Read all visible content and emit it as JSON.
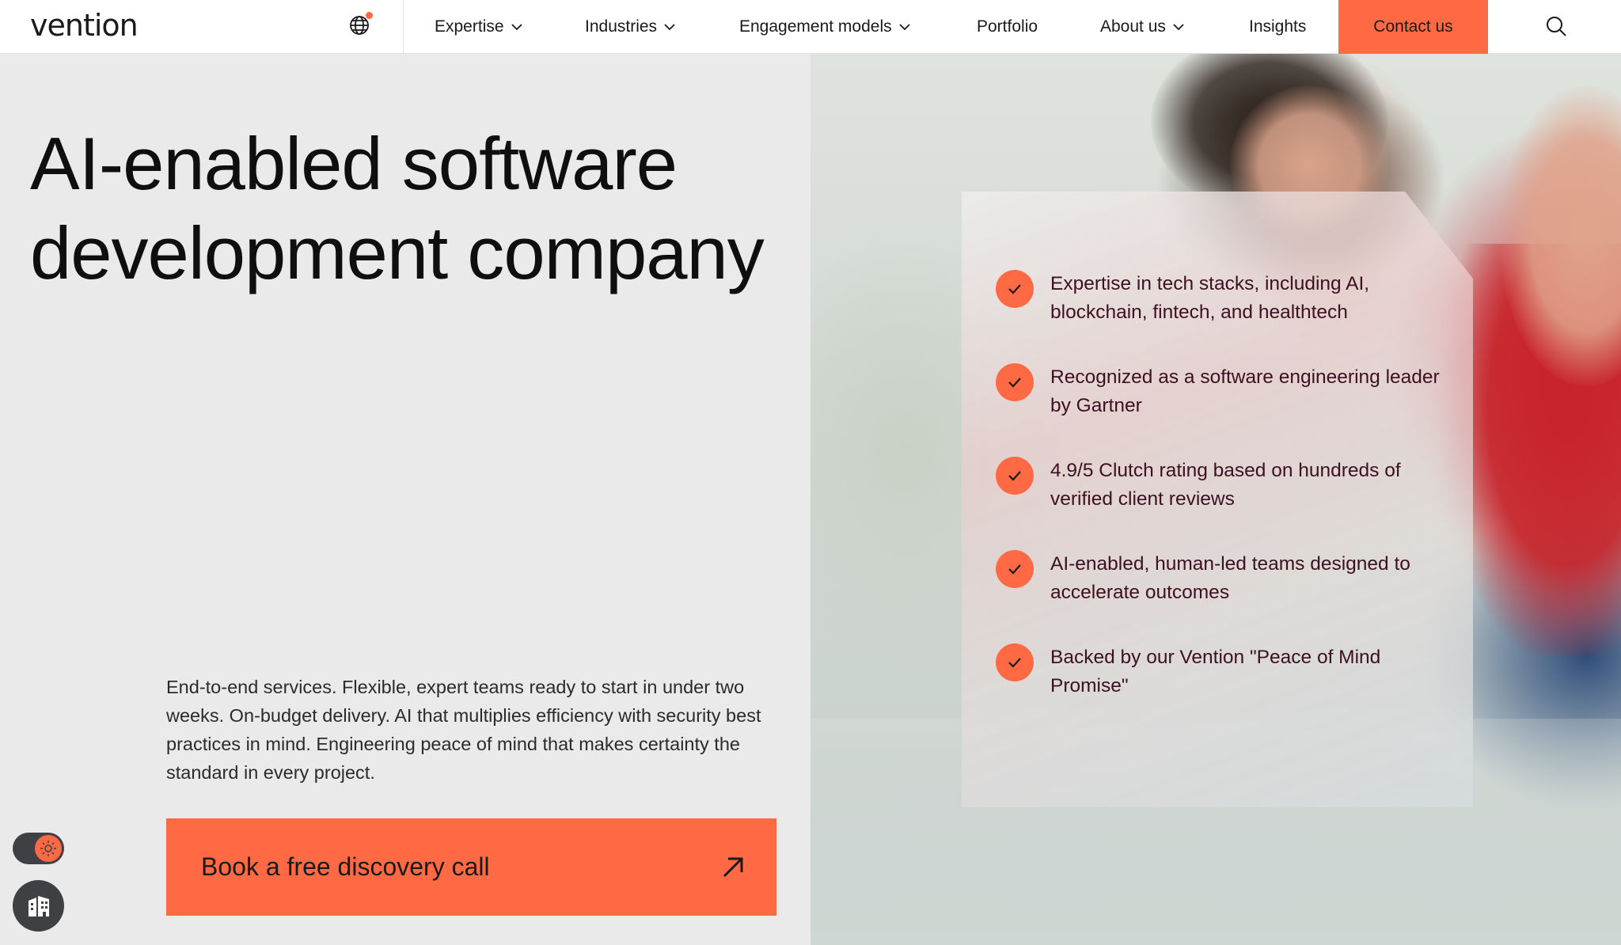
{
  "header": {
    "logo": "vention",
    "nav": [
      {
        "label": "Expertise",
        "has_dropdown": true
      },
      {
        "label": "Industries",
        "has_dropdown": true
      },
      {
        "label": "Engagement models",
        "has_dropdown": true
      },
      {
        "label": "Portfolio",
        "has_dropdown": false
      },
      {
        "label": "About us",
        "has_dropdown": true
      },
      {
        "label": "Insights",
        "has_dropdown": false
      }
    ],
    "contact_label": "Contact us",
    "icons": {
      "language": "globe-icon",
      "search": "search-icon",
      "dropdown": "chevron-down-icon"
    }
  },
  "hero": {
    "title": "AI-enabled software development company",
    "description": "End-to-end services. Flexible, expert teams ready to start in under two weeks. On-budget delivery. AI that multiplies efficiency with security best practices in mind. Engineering peace of mind that makes certainty the standard in every project.",
    "cta_label": "Book a free discovery call",
    "cta_icon": "arrow-up-right-icon"
  },
  "features": [
    "Expertise in tech stacks, including AI, blockchain, fintech, and healthtech",
    "Recognized as a software engineering leader by Gartner",
    "4.9/5 Clutch rating based on hundreds of verified client reviews",
    "AI-enabled, human-led teams designed to accelerate outcomes",
    "Backed by our Vention \"Peace of Mind Promise\""
  ],
  "widgets": {
    "theme_toggle_icon": "sun-icon",
    "accessibility_icon": "buildings-icon"
  },
  "colors": {
    "accent": "#ff6a45",
    "feature_text": "#3d1023",
    "page_bg": "#ebeaeb",
    "widget_bg": "#3f4043"
  }
}
